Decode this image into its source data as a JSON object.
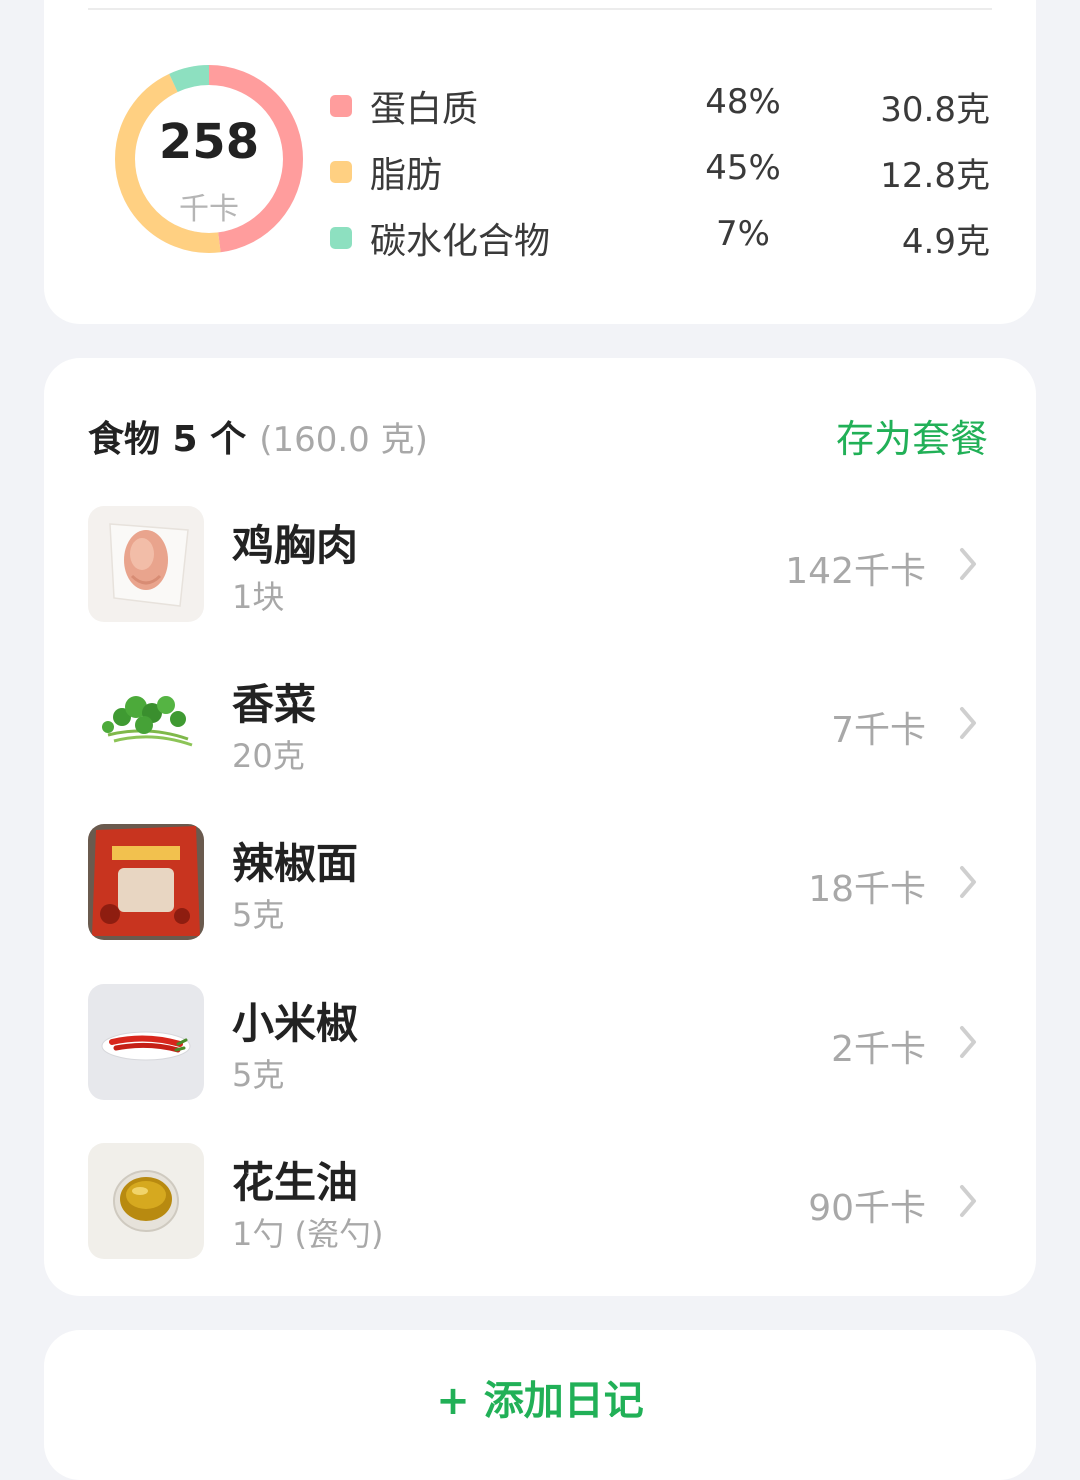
{
  "summary": {
    "kcal_value": "258",
    "kcal_unit": "千卡",
    "colors": {
      "protein": "#ff9d9d",
      "fat": "#ffd082",
      "carbs": "#8de0c0"
    },
    "macros": [
      {
        "name": "蛋白质",
        "percent": "48%",
        "amount": "30.8克",
        "share": 0.48
      },
      {
        "name": "脂肪",
        "percent": "45%",
        "amount": "12.8克",
        "share": 0.45
      },
      {
        "name": "碳水化合物",
        "percent": "7%",
        "amount": "4.9克",
        "share": 0.07
      }
    ]
  },
  "foods": {
    "title": "食物 5 个",
    "total_weight": "(160.0 克)",
    "save_combo_label": "存为套餐",
    "items": [
      {
        "name": "鸡胸肉",
        "qty": "1块",
        "kcal": "142千卡",
        "icon": "chicken-breast-photo"
      },
      {
        "name": "香菜",
        "qty": "20克",
        "kcal": "7千卡",
        "icon": "coriander-photo"
      },
      {
        "name": "辣椒面",
        "qty": "5克",
        "kcal": "18千卡",
        "icon": "chili-powder-bag-photo"
      },
      {
        "name": "小米椒",
        "qty": "5克",
        "kcal": "2千卡",
        "icon": "red-chili-photo"
      },
      {
        "name": "花生油",
        "qty": "1勺 (瓷勺)",
        "kcal": "90千卡",
        "icon": "peanut-oil-photo"
      }
    ]
  },
  "add_diary_label": "+ 添加日记",
  "accent_color": "#21b057"
}
